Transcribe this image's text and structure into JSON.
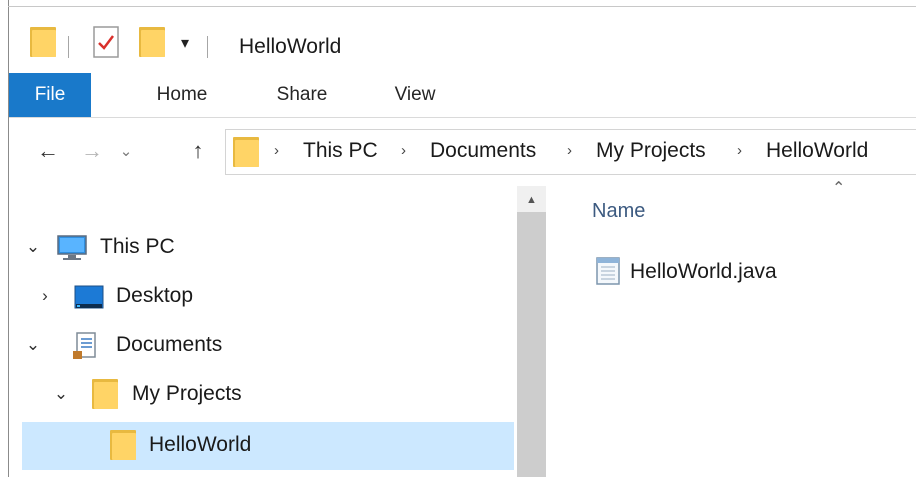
{
  "window": {
    "title": "HelloWorld"
  },
  "quick_access": {
    "customize_glyph": "▾",
    "icons": [
      "folder-icon",
      "properties-icon",
      "new-folder-icon"
    ]
  },
  "ribbon": {
    "tabs": [
      {
        "label": "File",
        "active": true
      },
      {
        "label": "Home"
      },
      {
        "label": "Share"
      },
      {
        "label": "View"
      }
    ]
  },
  "navigation": {
    "back_glyph": "←",
    "forward_glyph": "→",
    "recent_glyph": "⌄",
    "up_glyph": "↑"
  },
  "address": {
    "separator": "›",
    "crumbs": [
      "This PC",
      "Documents",
      "My Projects",
      "HelloWorld"
    ]
  },
  "tree": {
    "items": [
      {
        "label": "This PC",
        "expanded": true,
        "icon": "computer-icon"
      },
      {
        "label": "Desktop",
        "expanded": false,
        "icon": "desktop-icon"
      },
      {
        "label": "Documents",
        "expanded": true,
        "icon": "documents-icon"
      },
      {
        "label": "My Projects",
        "expanded": true,
        "icon": "folder-icon"
      },
      {
        "label": "HelloWorld",
        "selected": true,
        "icon": "folder-icon"
      }
    ],
    "expanded_glyph": "⌄",
    "collapsed_glyph": "›"
  },
  "content": {
    "column_header": "Name",
    "sort_glyph": "⌃",
    "files": [
      {
        "name": "HelloWorld.java",
        "icon": "text-file-icon"
      }
    ]
  },
  "colors": {
    "accent": "#1979ca",
    "selection": "#cce8ff",
    "folder": "#ffd466",
    "header_text": "#3c5a80"
  }
}
